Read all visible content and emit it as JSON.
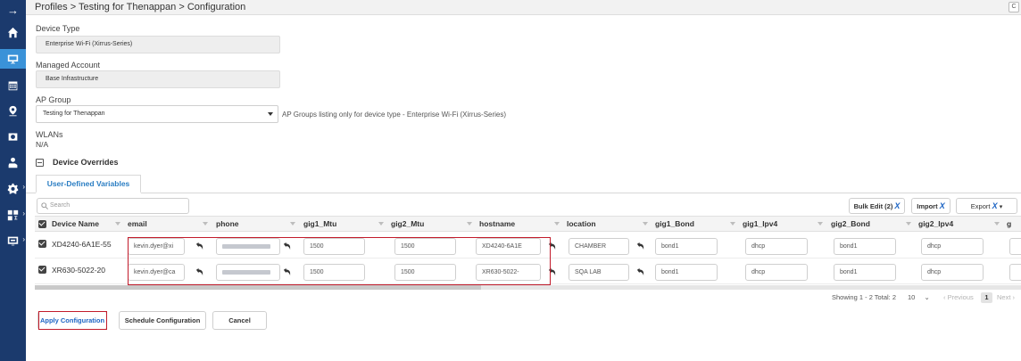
{
  "nav": {
    "items": [
      {
        "name": "collapse-arrow-icon",
        "glyph": "→"
      },
      {
        "name": "home-icon"
      },
      {
        "name": "monitor-icon"
      },
      {
        "name": "calendar-icon"
      },
      {
        "name": "location-pin-icon"
      },
      {
        "name": "camera-icon"
      },
      {
        "name": "user-hand-icon"
      },
      {
        "name": "gear-icon"
      },
      {
        "name": "network-icon"
      },
      {
        "name": "screen-icon"
      }
    ],
    "active_index": 2
  },
  "header": {
    "breadcrumb": "Profiles > Testing for Thenappan > Configuration",
    "right_button": "C"
  },
  "form": {
    "device_type_label": "Device Type",
    "device_type_value": "Enterprise Wi-Fi (Xirrus-Series)",
    "managed_account_label": "Managed Account",
    "managed_account_value": "Base Infrastructure",
    "ap_group_label": "AP Group",
    "ap_group_value": "Testing for Thenappan",
    "ap_group_hint": "AP Groups listing only for device type - Enterprise Wi-Fi (Xirrus-Series)",
    "wlans_label": "WLANs",
    "wlans_value": "N/A",
    "device_overrides_label": "Device Overrides"
  },
  "tabs": [
    {
      "label": "User-Defined Variables",
      "active": true
    }
  ],
  "toolbar": {
    "search_placeholder": "Search",
    "bulk_edit_label": "Bulk Edit (2)",
    "import_label": "Import",
    "export_label": "Export",
    "x_glyph": "X"
  },
  "table": {
    "columns": [
      "Device Name",
      "email",
      "phone",
      "gig1_Mtu",
      "gig2_Mtu",
      "hostname",
      "location",
      "gig1_Bond",
      "gig1_Ipv4",
      "gig2_Bond",
      "gig2_Ipv4",
      "g"
    ],
    "rows": [
      {
        "device_name": "XD4240-6A1E-55",
        "email": "kevin.dyer@xi",
        "phone": "",
        "gig1_mtu": "1500",
        "gig2_mtu": "1500",
        "hostname": "XD4240-6A1E",
        "location": "CHAMBER",
        "gig1_bond": "bond1",
        "gig1_ipv4": "dhcp",
        "gig2_bond": "bond1",
        "gig2_ipv4": "dhcp"
      },
      {
        "device_name": "XR630-5022-20",
        "email": "kevin.dyer@ca",
        "phone": "",
        "gig1_mtu": "1500",
        "gig2_mtu": "1500",
        "hostname": "XR630-5022-",
        "location": "SQA LAB",
        "gig1_bond": "bond1",
        "gig1_ipv4": "dhcp",
        "gig2_bond": "bond1",
        "gig2_ipv4": "dhcp"
      }
    ]
  },
  "pagination": {
    "summary": "Showing 1 - 2 Total: 2",
    "page_size": "10",
    "previous": "‹ Previous",
    "current_page": "1",
    "next": "Next ›"
  },
  "actions": {
    "apply": "Apply Configuration",
    "schedule": "Schedule Configuration",
    "cancel": "Cancel"
  },
  "colors": {
    "nav_bg": "#1b3a6d",
    "nav_active": "#3a92d8",
    "accent": "#1c64c4",
    "highlight_red": "#c21b2b"
  }
}
